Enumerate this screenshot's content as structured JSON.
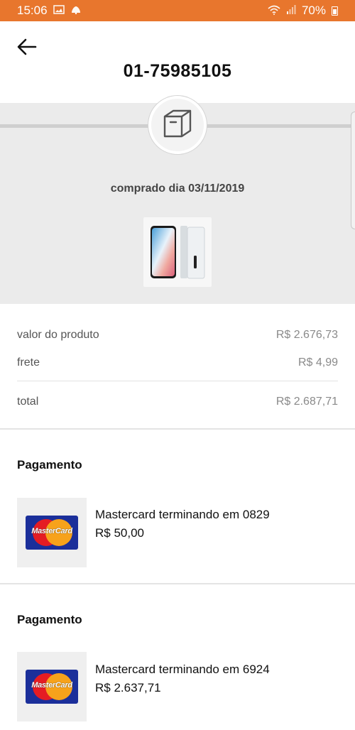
{
  "status_bar": {
    "time": "15:06",
    "left_icons": [
      "screen-cast-icon",
      "notification-icon"
    ],
    "battery_percent": "70%",
    "right_icons": [
      "wifi-icon",
      "signal-icon",
      "battery-icon"
    ]
  },
  "header": {
    "back_icon": "arrow-left-icon",
    "order_number": "01-75985105"
  },
  "hero": {
    "icon": "box-icon",
    "purchase_date": "comprado dia 03/11/2019",
    "product_image": "smartphone-product-image"
  },
  "summary": {
    "product_value_label": "valor do produto",
    "product_value": "R$ 2.676,73",
    "shipping_label": "frete",
    "shipping_value": "R$ 4,99",
    "total_label": "total",
    "total_value": "R$ 2.687,71"
  },
  "payments": [
    {
      "title": "Pagamento",
      "card_brand_logo": "MasterCard",
      "card_description": "Mastercard terminando em 0829",
      "amount": "R$ 50,00"
    },
    {
      "title": "Pagamento",
      "card_brand_logo": "MasterCard",
      "card_description": "Mastercard terminando em 6924",
      "amount": "R$ 2.637,71"
    }
  ],
  "colors": {
    "status_bar": "#e8762d",
    "hero_background": "#ebebeb",
    "mastercard_blue": "#1b2f9a",
    "mastercard_red": "#e51c23",
    "mastercard_yellow": "#f7a21b"
  }
}
